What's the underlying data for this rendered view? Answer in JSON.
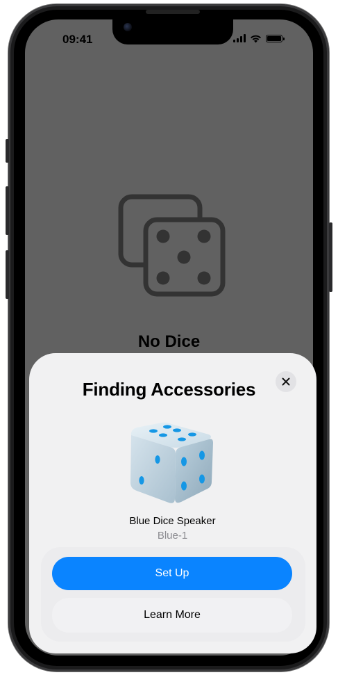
{
  "status_bar": {
    "time": "09:41"
  },
  "background": {
    "empty_title": "No Dice"
  },
  "sheet": {
    "title": "Finding Accessories",
    "accessory_name": "Blue Dice Speaker",
    "accessory_id": "Blue-1",
    "primary_button": "Set Up",
    "secondary_button": "Learn More"
  },
  "colors": {
    "accent": "#0a84ff",
    "dimmed_background": "#616161",
    "sheet_background": "#f1f1f2",
    "secondary_text": "#8b8b90"
  },
  "icons": {
    "close": "close-icon",
    "empty_state": "dice-icon",
    "accessory": "dice-cube-icon"
  }
}
